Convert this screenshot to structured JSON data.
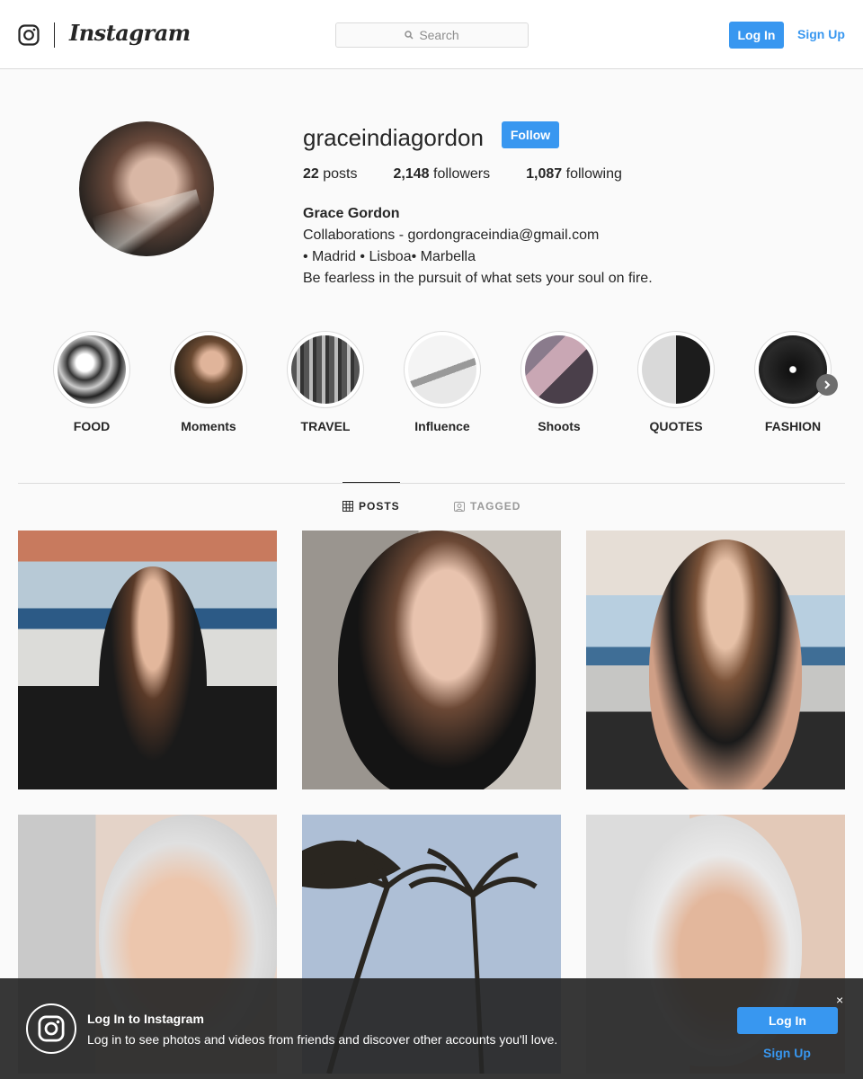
{
  "header": {
    "logo_icon": "instagram-glyph-icon",
    "wordmark": "Instagram",
    "search_placeholder": "Search",
    "login_label": "Log In",
    "signup_label": "Sign Up"
  },
  "profile": {
    "username": "graceindiagordon",
    "follow_label": "Follow",
    "stats": {
      "posts_count": "22",
      "posts_label": "posts",
      "followers_count": "2,148",
      "followers_label": "followers",
      "following_count": "1,087",
      "following_label": "following"
    },
    "bio": {
      "name": "Grace Gordon",
      "line1": "Collaborations - gordongraceindia@gmail.com",
      "line2": "• Madrid • Lisboa• Marbella",
      "line3": "Be fearless in the pursuit of what sets your soul on fire."
    }
  },
  "highlights": [
    {
      "label": "FOOD"
    },
    {
      "label": "Moments"
    },
    {
      "label": "TRAVEL"
    },
    {
      "label": "Influence"
    },
    {
      "label": "Shoots"
    },
    {
      "label": "QUOTES"
    },
    {
      "label": "FASHION"
    }
  ],
  "tabs": {
    "posts": "POSTS",
    "tagged": "TAGGED"
  },
  "banner": {
    "title": "Log In to Instagram",
    "text": "Log in to see photos and videos from friends and discover other accounts you'll love.",
    "close": "×",
    "login_label": "Log In",
    "signup_label": "Sign Up"
  },
  "colors": {
    "accent": "#3897f0",
    "text": "#262626",
    "border": "#dbdbdb",
    "background": "#fafafa"
  }
}
